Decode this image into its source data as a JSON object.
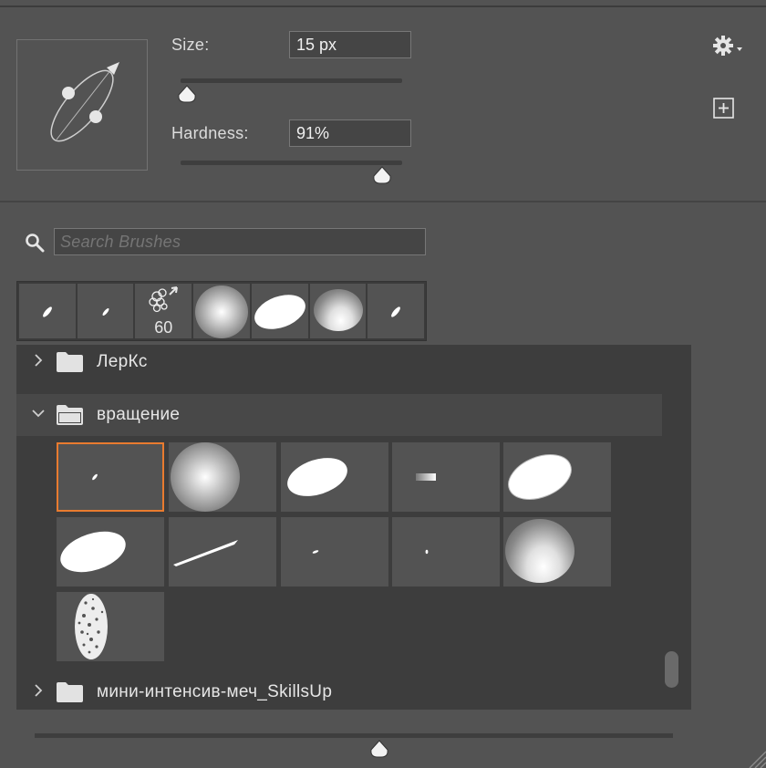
{
  "brush_settings": {
    "size_label": "Size:",
    "size_value": "15 px",
    "size_slider_pct": 3,
    "hardness_label": "Hardness:",
    "hardness_value": "91%",
    "hardness_slider_pct": 91
  },
  "search": {
    "placeholder": "Search Brushes"
  },
  "recent_brushes": {
    "count_badge": "60"
  },
  "folders": {
    "first": "ЛерКс",
    "expanded": "вращение",
    "last": "мини-интенсив-меч_SkillsUp"
  },
  "icons": {
    "search": "search-icon",
    "gear": "gear-icon",
    "new_preset": "new-preset-icon",
    "folder": "folder-icon",
    "chevron_right": "chevron-right-icon",
    "chevron_down": "chevron-down-icon"
  },
  "colors": {
    "selection": "#e97b2f",
    "panel": "#535353"
  },
  "preview_size_slider_pct": 54
}
